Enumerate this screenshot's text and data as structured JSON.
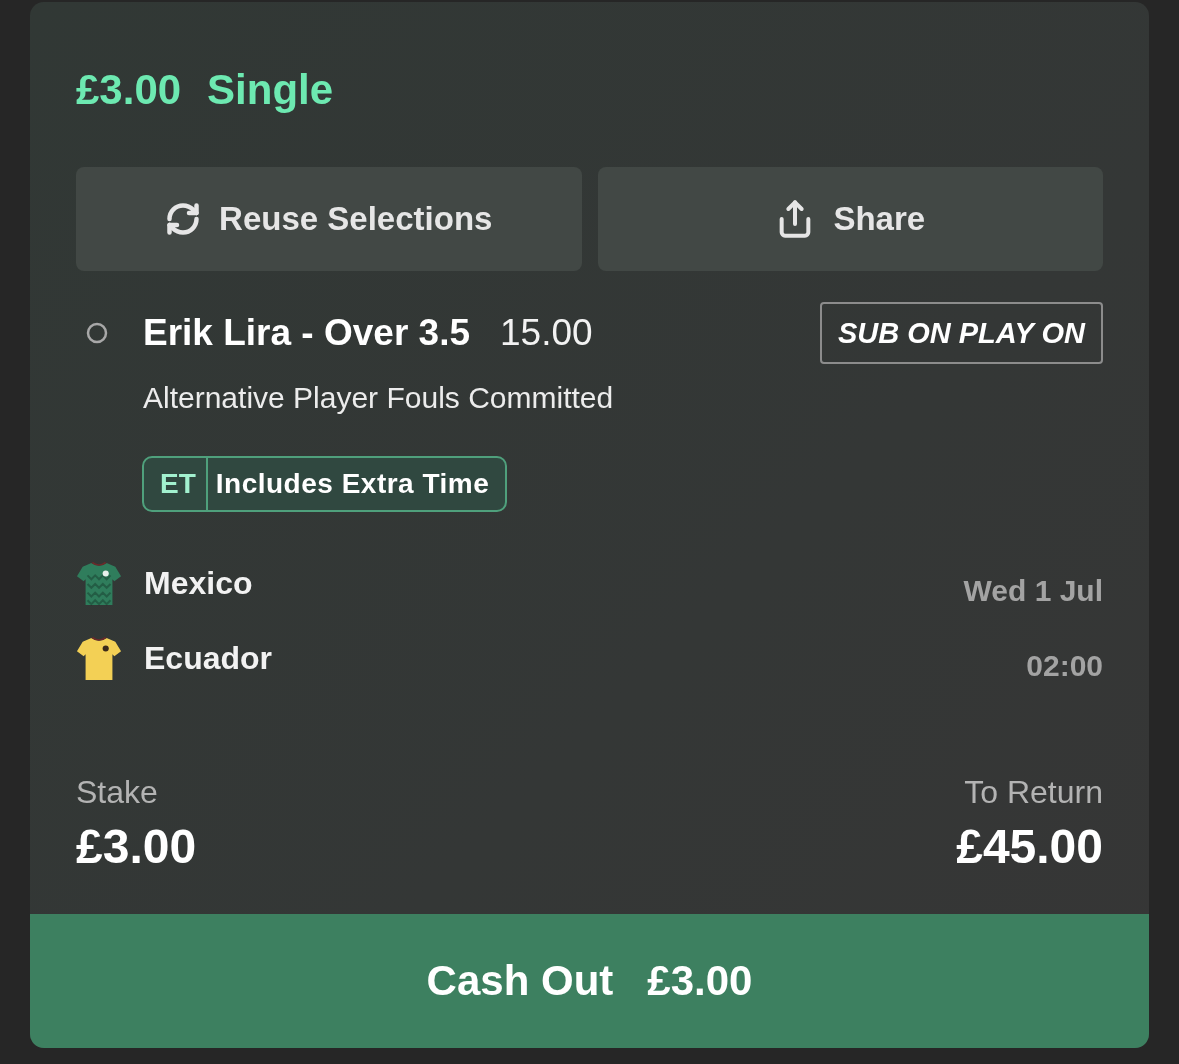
{
  "header": {
    "stake": "£3.00",
    "bet_type": "Single"
  },
  "actions": [
    {
      "kind": "reuse",
      "label": "Reuse Selections"
    },
    {
      "kind": "share",
      "label": "Share"
    }
  ],
  "selection": {
    "title": "Erik Lira - Over 3.5",
    "odds": "15.00",
    "badge": "SUB ON PLAY ON",
    "market": "Alternative Player Fouls Committed",
    "tag": {
      "code": "ET",
      "label": "Includes Extra Time"
    }
  },
  "event": {
    "teams": [
      {
        "name": "Mexico",
        "color": "#2f7d5c",
        "kind": "zigzag"
      },
      {
        "name": "Ecuador",
        "color": "#f3d055",
        "kind": "plain"
      }
    ],
    "date": "Wed 1 Jul",
    "time": "02:00"
  },
  "totals": [
    {
      "label": "Stake",
      "value": "£3.00"
    },
    {
      "label": "To Return",
      "value": "£45.00"
    }
  ],
  "cash_out": {
    "label": "Cash Out",
    "amount": "£3.00"
  }
}
